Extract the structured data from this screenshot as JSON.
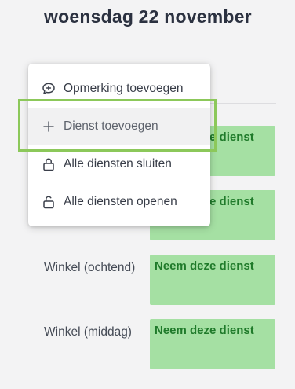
{
  "header": {
    "title": "woensdag 22 november"
  },
  "menu": {
    "items": [
      {
        "label": "Opmerking toevoegen",
        "icon": "comment-plus-icon"
      },
      {
        "label": "Dienst toevoegen",
        "icon": "plus-icon"
      },
      {
        "label": "Alle diensten sluiten",
        "icon": "lock-closed-icon"
      },
      {
        "label": "Alle diensten openen",
        "icon": "lock-open-icon"
      }
    ]
  },
  "rows": [
    {
      "shift_label": "Neem deze dienst"
    },
    {
      "shift_label": "Neem deze dienst"
    },
    {
      "label": "Winkel (ochtend)",
      "shift_label": "Neem deze dienst"
    },
    {
      "label": "Winkel (middag)",
      "shift_label": "Neem deze dienst"
    }
  ],
  "colors": {
    "shift_bg": "#a5e0a3",
    "shift_text": "#1f7a2a",
    "highlight_border": "#8cc85a"
  }
}
